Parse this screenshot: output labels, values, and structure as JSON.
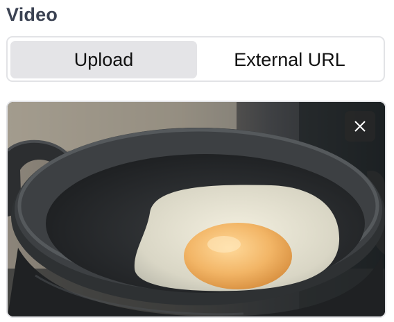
{
  "field": {
    "label": "Video"
  },
  "source_tabs": {
    "upload_label": "Upload",
    "external_label": "External URL",
    "selected": "Upload"
  },
  "preview": {
    "subject": "fried egg in cast iron pan",
    "close_icon": "close-icon"
  },
  "colors": {
    "label_text": "#3b4252",
    "selected_tab_bg": "#e4e4e7",
    "border": "#e2e3e6"
  }
}
